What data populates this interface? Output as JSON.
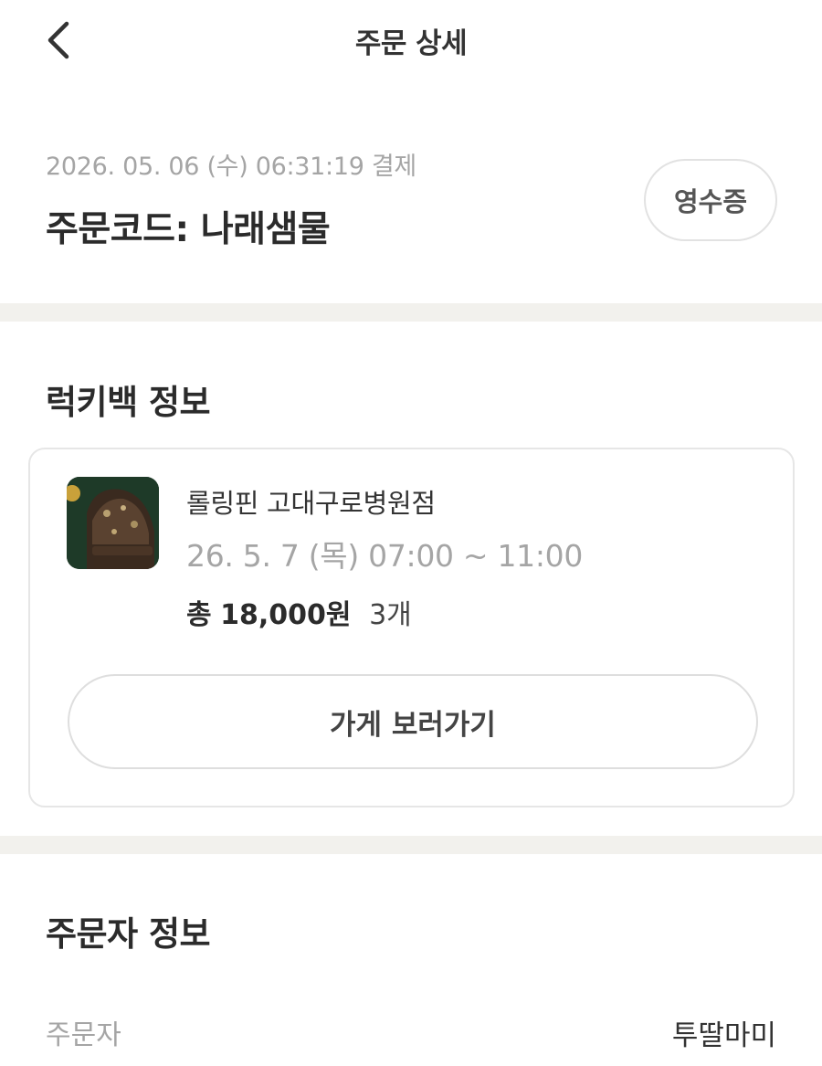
{
  "header": {
    "title": "주문 상세",
    "back_icon": "chevron-left-icon"
  },
  "order": {
    "paid_at": "2026. 05. 06 (수) 06:31:19 결제",
    "code": "주문코드: 나래샘물",
    "receipt_label": "영수증"
  },
  "luckybag": {
    "section_title": "럭키백 정보",
    "store_name": "롤링핀 고대구로병원점",
    "pickup_time": "26. 5. 7 (목) 07:00 ~ 11:00",
    "total_label": "총",
    "total_amount": "18,000원",
    "quantity": "3개",
    "visit_store_label": "가게 보러가기"
  },
  "orderer": {
    "section_title": "주문자 정보",
    "name_label": "주문자",
    "name_value": "투딸마미"
  },
  "colors": {
    "divider": "#f2f1ed",
    "muted_text": "#a5a5a5",
    "primary_text": "#2b2b2b"
  }
}
